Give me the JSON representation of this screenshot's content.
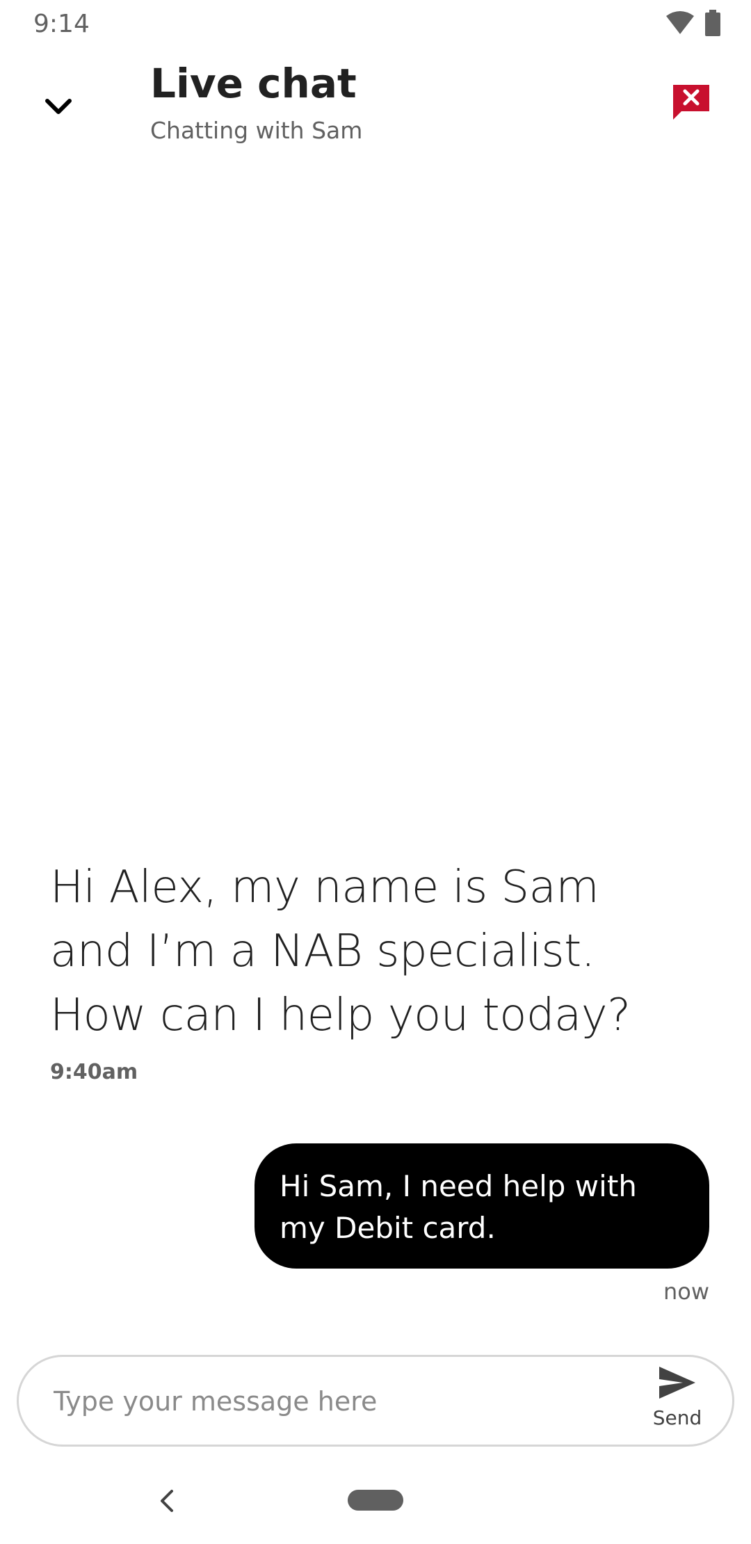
{
  "status_bar": {
    "time": "9:14",
    "icons": [
      "wifi-icon",
      "battery-icon"
    ]
  },
  "header": {
    "title": "Live chat",
    "subtitle": "Chatting with Sam",
    "collapse_icon": "chevron-down-icon",
    "end_chat_icon": "end-chat-icon"
  },
  "messages": [
    {
      "sender": "agent",
      "text": "Hi Alex, my name is Sam and I’m a NAB specialist. How can I help you today?",
      "time": "9:40am"
    },
    {
      "sender": "user",
      "text": "Hi Sam, I need help with my Debit card.",
      "time": "now"
    }
  ],
  "composer": {
    "placeholder": "Type your message here",
    "value": "",
    "send_label": "Send",
    "send_icon": "send-icon"
  },
  "nav_bar": {
    "icons": [
      "back-icon",
      "home-pill-icon"
    ]
  },
  "colors": {
    "accent_red": "#c8102e",
    "bubble_user": "#000000",
    "text_primary": "#212121",
    "text_secondary": "#616161"
  }
}
